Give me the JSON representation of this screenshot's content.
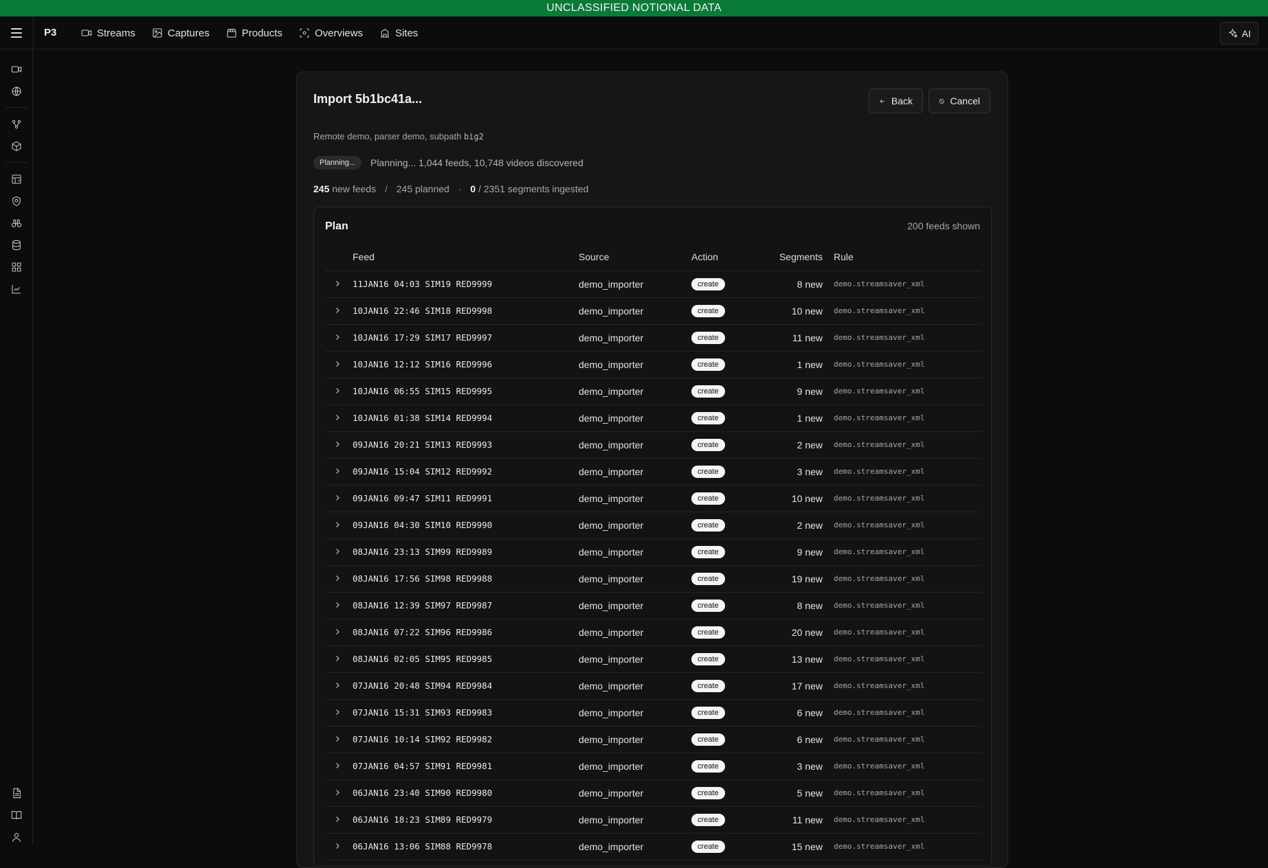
{
  "banner": {
    "text": "UNCLASSIFIED NOTIONAL DATA",
    "color": "#0a7a37"
  },
  "topbar": {
    "menu_icon": "hamburger-icon",
    "brand": "P3",
    "nav": [
      {
        "label": "Streams",
        "icon": "video-icon"
      },
      {
        "label": "Captures",
        "icon": "image-icon"
      },
      {
        "label": "Products",
        "icon": "clapperboard-icon"
      },
      {
        "label": "Overviews",
        "icon": "scan-eye-icon"
      },
      {
        "label": "Sites",
        "icon": "building-icon"
      }
    ],
    "ai_label": "AI"
  },
  "sidebar": {
    "icons": [
      "video-icon",
      "globe-icon",
      "workflow-icon",
      "package-icon",
      "layout-icon",
      "shield-icon",
      "binoculars-icon",
      "database-icon",
      "grid-icon",
      "chart-icon",
      "document-icon",
      "book-icon",
      "user-icon"
    ]
  },
  "import": {
    "title": "Import 5b1bc41a...",
    "back_label": "Back",
    "cancel_label": "Cancel",
    "subtitle_prefix": "Remote demo, parser demo, subpath",
    "subpath": "big2",
    "status_pill": "Planning...",
    "status_text": "Planning... 1,044 feeds, 10,748 videos discovered",
    "new_feeds": "245",
    "new_feeds_label": "new feeds",
    "planned": "245 planned",
    "ingested": "0",
    "ingested_label": "/ 2351 segments ingested"
  },
  "plan": {
    "title": "Plan",
    "shown": "200 feeds shown",
    "columns": {
      "feed": "Feed",
      "source": "Source",
      "action": "Action",
      "segments": "Segments",
      "rule": "Rule"
    },
    "rows": [
      {
        "feed": "11JAN16 04:03 SIM19 RED9999",
        "source": "demo_importer",
        "action": "create",
        "segments": "8 new",
        "rule": "demo.streamsaver_xml"
      },
      {
        "feed": "10JAN16 22:46 SIM18 RED9998",
        "source": "demo_importer",
        "action": "create",
        "segments": "10 new",
        "rule": "demo.streamsaver_xml"
      },
      {
        "feed": "10JAN16 17:29 SIM17 RED9997",
        "source": "demo_importer",
        "action": "create",
        "segments": "11 new",
        "rule": "demo.streamsaver_xml"
      },
      {
        "feed": "10JAN16 12:12 SIM16 RED9996",
        "source": "demo_importer",
        "action": "create",
        "segments": "1 new",
        "rule": "demo.streamsaver_xml"
      },
      {
        "feed": "10JAN16 06:55 SIM15 RED9995",
        "source": "demo_importer",
        "action": "create",
        "segments": "9 new",
        "rule": "demo.streamsaver_xml"
      },
      {
        "feed": "10JAN16 01:38 SIM14 RED9994",
        "source": "demo_importer",
        "action": "create",
        "segments": "1 new",
        "rule": "demo.streamsaver_xml"
      },
      {
        "feed": "09JAN16 20:21 SIM13 RED9993",
        "source": "demo_importer",
        "action": "create",
        "segments": "2 new",
        "rule": "demo.streamsaver_xml"
      },
      {
        "feed": "09JAN16 15:04 SIM12 RED9992",
        "source": "demo_importer",
        "action": "create",
        "segments": "3 new",
        "rule": "demo.streamsaver_xml"
      },
      {
        "feed": "09JAN16 09:47 SIM11 RED9991",
        "source": "demo_importer",
        "action": "create",
        "segments": "10 new",
        "rule": "demo.streamsaver_xml"
      },
      {
        "feed": "09JAN16 04:30 SIM10 RED9990",
        "source": "demo_importer",
        "action": "create",
        "segments": "2 new",
        "rule": "demo.streamsaver_xml"
      },
      {
        "feed": "08JAN16 23:13 SIM99 RED9989",
        "source": "demo_importer",
        "action": "create",
        "segments": "9 new",
        "rule": "demo.streamsaver_xml"
      },
      {
        "feed": "08JAN16 17:56 SIM98 RED9988",
        "source": "demo_importer",
        "action": "create",
        "segments": "19 new",
        "rule": "demo.streamsaver_xml"
      },
      {
        "feed": "08JAN16 12:39 SIM97 RED9987",
        "source": "demo_importer",
        "action": "create",
        "segments": "8 new",
        "rule": "demo.streamsaver_xml"
      },
      {
        "feed": "08JAN16 07:22 SIM96 RED9986",
        "source": "demo_importer",
        "action": "create",
        "segments": "20 new",
        "rule": "demo.streamsaver_xml"
      },
      {
        "feed": "08JAN16 02:05 SIM95 RED9985",
        "source": "demo_importer",
        "action": "create",
        "segments": "13 new",
        "rule": "demo.streamsaver_xml"
      },
      {
        "feed": "07JAN16 20:48 SIM94 RED9984",
        "source": "demo_importer",
        "action": "create",
        "segments": "17 new",
        "rule": "demo.streamsaver_xml"
      },
      {
        "feed": "07JAN16 15:31 SIM93 RED9983",
        "source": "demo_importer",
        "action": "create",
        "segments": "6 new",
        "rule": "demo.streamsaver_xml"
      },
      {
        "feed": "07JAN16 10:14 SIM92 RED9982",
        "source": "demo_importer",
        "action": "create",
        "segments": "6 new",
        "rule": "demo.streamsaver_xml"
      },
      {
        "feed": "07JAN16 04:57 SIM91 RED9981",
        "source": "demo_importer",
        "action": "create",
        "segments": "3 new",
        "rule": "demo.streamsaver_xml"
      },
      {
        "feed": "06JAN16 23:40 SIM90 RED9980",
        "source": "demo_importer",
        "action": "create",
        "segments": "5 new",
        "rule": "demo.streamsaver_xml"
      },
      {
        "feed": "06JAN16 18:23 SIM89 RED9979",
        "source": "demo_importer",
        "action": "create",
        "segments": "11 new",
        "rule": "demo.streamsaver_xml"
      },
      {
        "feed": "06JAN16 13:06 SIM88 RED9978",
        "source": "demo_importer",
        "action": "create",
        "segments": "15 new",
        "rule": "demo.streamsaver_xml"
      }
    ]
  }
}
